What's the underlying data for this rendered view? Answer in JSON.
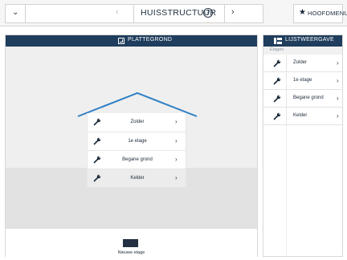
{
  "topbar": {
    "dropdown_icon": "chevron-down-icon",
    "prev_icon": "chevron-left-icon",
    "title": "HUISSTRUCTUUR",
    "help_icon": "help-icon",
    "help_glyph": "?",
    "next_icon": "chevron-right-icon",
    "menu_label": "HOOFDMENU",
    "menu_icon": "star-icon"
  },
  "floorplan": {
    "header": "PLATTEGROND",
    "header_icon": "floorplan-icon",
    "floors": [
      {
        "label": "Zolder",
        "selected": false
      },
      {
        "label": "1e etage",
        "selected": false
      },
      {
        "label": "Begane grond",
        "selected": false
      },
      {
        "label": "Kelder",
        "selected": true
      }
    ],
    "new_floor_label": "Nieuwe etage"
  },
  "listview": {
    "header": "LIJSTWEERGAVE",
    "header_icon": "list-view-icon",
    "section_label": "Etagen",
    "items": [
      {
        "label": "Zolder"
      },
      {
        "label": "1e etage"
      },
      {
        "label": "Begane grond"
      },
      {
        "label": "Kelder"
      }
    ]
  },
  "colors": {
    "header_bg": "#1f3d5c",
    "roof_stroke": "#2f7fc4",
    "panel_bg": "#efefef"
  }
}
